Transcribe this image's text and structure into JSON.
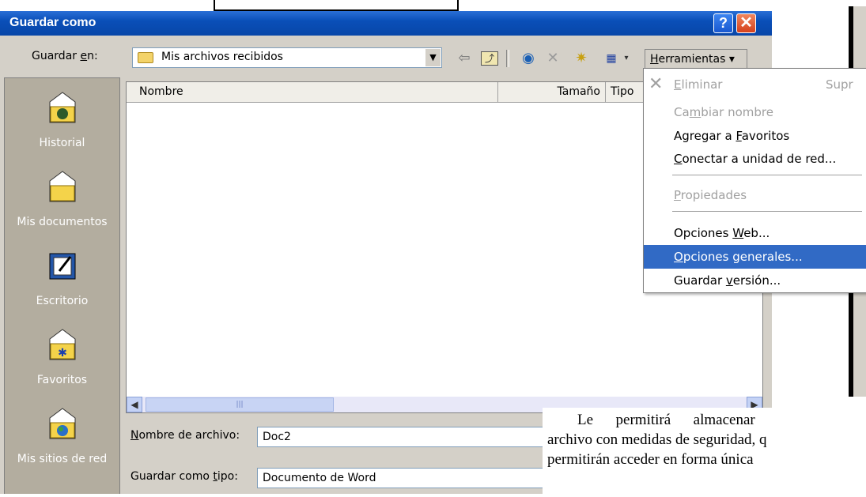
{
  "dialog": {
    "title": "Guardar como",
    "help_glyph": "?",
    "close_glyph": "✕",
    "save_in_label_pre": "Guardar ",
    "save_in_label_u": "e",
    "save_in_label_post": "n:",
    "location": "Mis archivos recibidos",
    "toolbar": {
      "back_icon": "back-arrow-icon",
      "up_icon": "up-folder-icon",
      "search_icon": "search-web-icon",
      "delete_icon": "delete-icon",
      "new_folder_icon": "new-folder-icon",
      "views_icon": "views-icon",
      "tools_label_pre": "",
      "tools_label_u": "H",
      "tools_label_post": "erramientas ▾"
    },
    "places": [
      {
        "label": "Historial",
        "icon": "history-icon"
      },
      {
        "label": "Mis documentos",
        "icon": "my-documents-icon"
      },
      {
        "label": "Escritorio",
        "icon": "desktop-icon"
      },
      {
        "label": "Favoritos",
        "icon": "favorites-icon"
      },
      {
        "label": "Mis sitios de red",
        "icon": "network-places-icon"
      }
    ],
    "columns": [
      "Nombre",
      "Tamaño",
      "Tipo"
    ],
    "filename_label_pre": "",
    "filename_label_u": "N",
    "filename_label_post": "ombre de archivo:",
    "filename_value": "Doc2",
    "filetype_label_pre": "Guardar como ",
    "filetype_label_u": "t",
    "filetype_label_post": "ipo:",
    "filetype_value": "Documento de Word"
  },
  "menu": {
    "items": [
      {
        "pre": "",
        "u": "E",
        "post": "liminar",
        "shortcut": "Supr",
        "disabled": true
      },
      {
        "pre": "Ca",
        "u": "m",
        "post": "biar nombre",
        "disabled": true
      },
      {
        "pre": "Agregar a ",
        "u": "F",
        "post": "avoritos",
        "disabled": false
      },
      {
        "pre": "",
        "u": "C",
        "post": "onectar a unidad de red...",
        "disabled": false
      },
      {
        "pre": "",
        "u": "P",
        "post": "ropiedades",
        "disabled": true
      },
      {
        "pre": "Opciones ",
        "u": "W",
        "post": "eb...",
        "disabled": false
      },
      {
        "pre": "",
        "u": "O",
        "post": "pciones generales...",
        "disabled": false,
        "selected": true
      },
      {
        "pre": "Guardar ",
        "u": "v",
        "post": "ersión...",
        "disabled": false
      }
    ]
  },
  "document": {
    "lines": [
      "        Le      permitirá      almacenar",
      "archivo con medidas de seguridad, q",
      "permitirán acceder en forma única"
    ]
  },
  "colors": {
    "titlebar": "#0a4fb8",
    "selection": "#316ac5",
    "places_bg": "#b3ad9f"
  }
}
